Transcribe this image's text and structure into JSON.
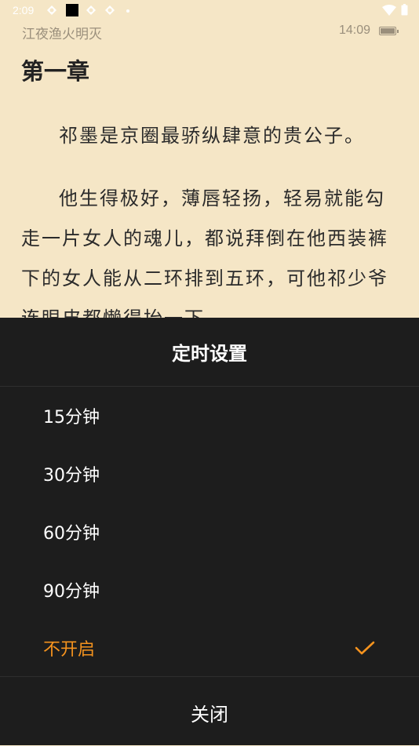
{
  "status_bar": {
    "time": "2:09",
    "icons": [
      "app-icon",
      "black-square-icon",
      "app-icon",
      "app-icon"
    ],
    "right_icons": [
      "wifi-icon",
      "battery-icon"
    ]
  },
  "reader": {
    "book_title": "江夜渔火明灭",
    "clock": "14:09",
    "chapter_title": "第一章",
    "paragraphs": [
      "祁墨是京圈最骄纵肆意的贵公子。",
      "他生得极好，薄唇轻扬，轻易就能勾走一片女人的魂儿，都说拜倒在他西装裤下的女人能从二环排到五环，可他祁少爷连眼皮都懒得抬一下。"
    ]
  },
  "timer_panel": {
    "title": "定时设置",
    "options": [
      {
        "label": "15分钟",
        "selected": false
      },
      {
        "label": "30分钟",
        "selected": false
      },
      {
        "label": "60分钟",
        "selected": false
      },
      {
        "label": "90分钟",
        "selected": false
      },
      {
        "label": "不开启",
        "selected": true
      }
    ],
    "close_label": "关闭",
    "accent_color": "#f5931e"
  }
}
